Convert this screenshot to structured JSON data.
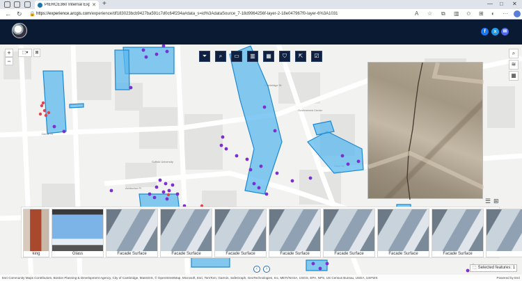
{
  "browser": {
    "tab_title": "PIERCE360 Internal Experience",
    "url_host": "https://experience.arcgis.com",
    "url_path": "/experience/df183023bcb9427ba591c7d0c64f234a#data_s=id%3AdataSource_7-18d9964256f-layer-2-18e047967f0-layer-6%3A1031"
  },
  "gallery": {
    "cards": [
      {
        "label": "king",
        "tone": "brick"
      },
      {
        "label": "Glass",
        "tone": "sky"
      },
      {
        "label": "Facade Surface",
        "tone": "stone"
      },
      {
        "label": "Facade Surface",
        "tone": "stone"
      },
      {
        "label": "Facade Surface",
        "tone": "stone"
      },
      {
        "label": "Facade Surface",
        "tone": "stone"
      },
      {
        "label": "Facade Surface",
        "tone": "stone"
      },
      {
        "label": "Facade Surface",
        "tone": "stone"
      },
      {
        "label": "Facade Surface",
        "tone": "stone"
      },
      {
        "label": "",
        "tone": "stone"
      }
    ]
  },
  "selection": {
    "text": "Selected features: 1"
  },
  "attribution": {
    "text": "Esri Community Maps Contributors, Boston Planning & Development Agency, City of Cambridge, MassGIS, © OpenStreetMap, Microsoft, Esri, TomTom, Garmin, SafeGraph, GeoTechnologies, Inc, METI/NASA, USGS, EPA, NPS, US Census Bureau, USDA, USFWS",
    "powered": "Powered by Esri"
  },
  "map": {
    "streets": [
      "Pemberton Sq",
      "Ashburton Pl",
      "Derne St",
      "Somerset St",
      "Suffolk University",
      "Court St",
      "Cambridge St",
      "Government Center",
      "Tremont St",
      "Bowdoin St"
    ]
  },
  "colors": {
    "header": "#0b1a33",
    "polygon_fill": "#5bb8ee",
    "polygon_stroke": "#1e88d0",
    "point": "#7b2fd1",
    "point_alt": "#e0444f"
  }
}
